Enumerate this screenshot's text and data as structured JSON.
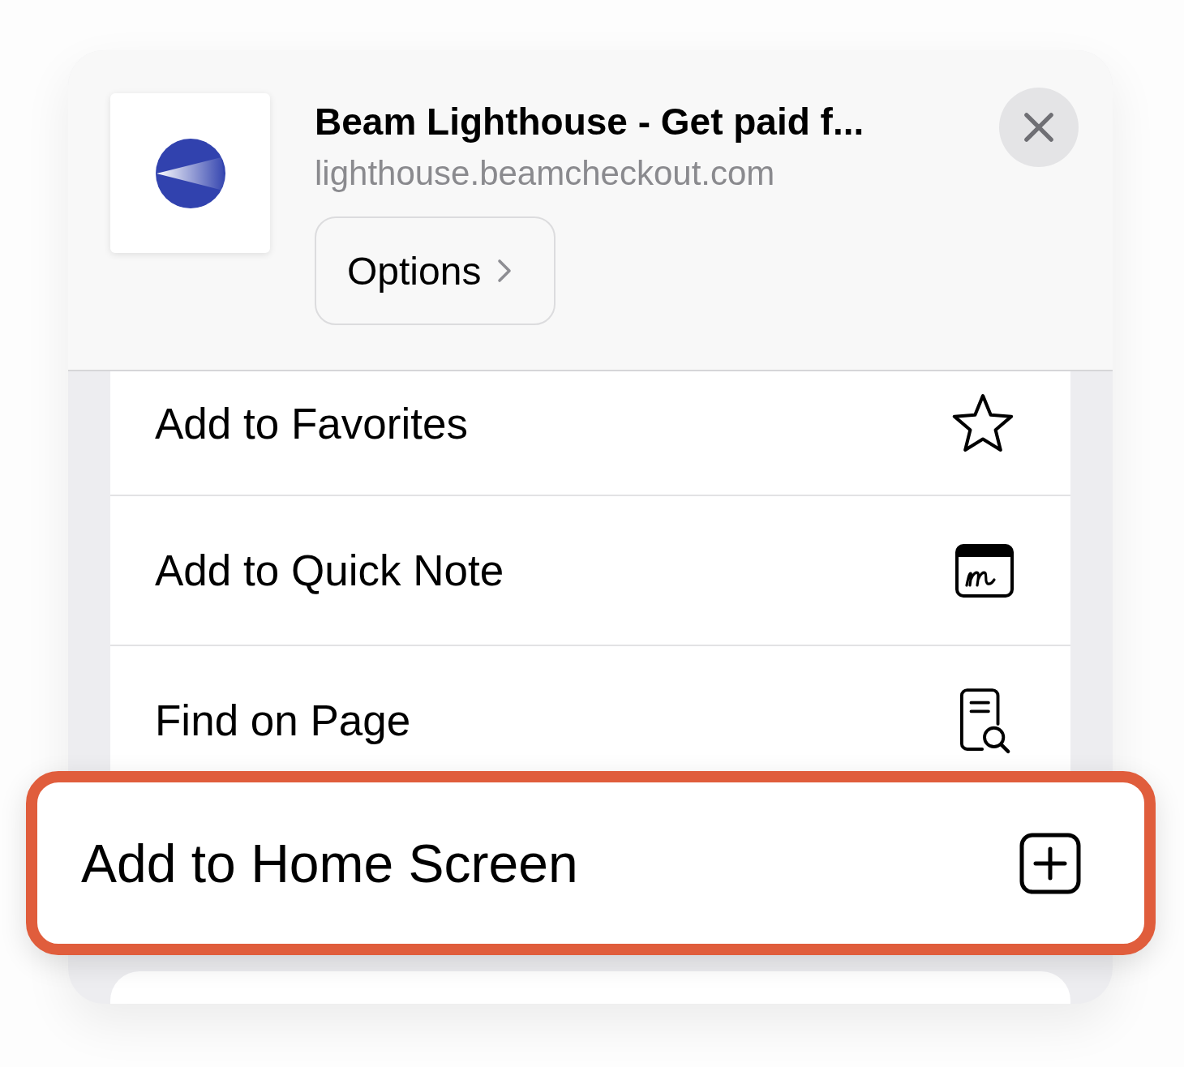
{
  "share_sheet": {
    "header": {
      "title": "Beam Lighthouse - Get paid f...",
      "url": "lighthouse.beamcheckout.com",
      "options_label": "Options"
    },
    "actions": [
      {
        "label": "Add to Favorites",
        "kind": "favorite",
        "highlighted": false
      },
      {
        "label": "Add to Quick Note",
        "kind": "note",
        "highlighted": false
      },
      {
        "label": "Find on Page",
        "kind": "find",
        "highlighted": false
      },
      {
        "label": "Add to Home Screen",
        "kind": "home",
        "highlighted": true
      }
    ]
  }
}
